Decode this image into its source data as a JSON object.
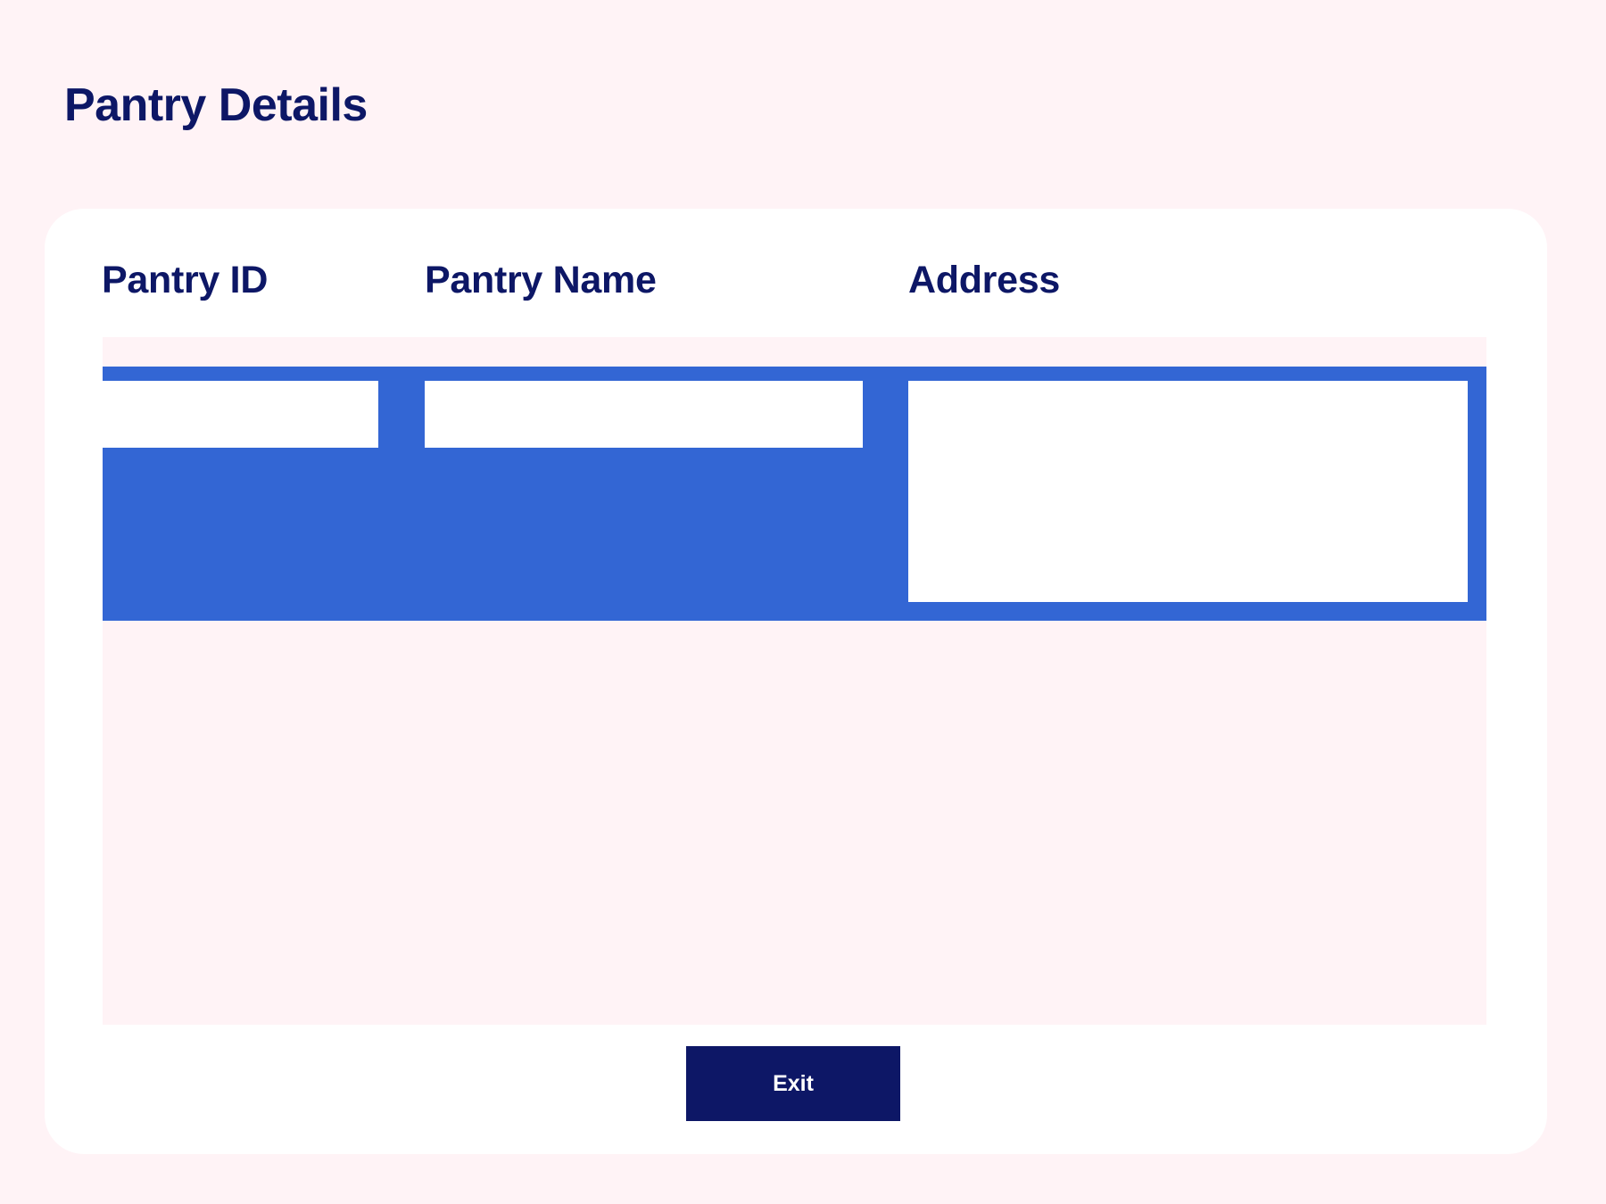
{
  "page": {
    "title": "Pantry Details"
  },
  "table": {
    "columns": [
      "Pantry ID",
      "Pantry Name",
      "Address"
    ],
    "selected_row": {
      "pantry_id": "",
      "pantry_name": "",
      "address": ""
    }
  },
  "actions": {
    "exit_label": "Exit"
  },
  "colors": {
    "background": "#fff3f6",
    "primary_text": "#0d1766",
    "selection": "#3366d4",
    "button": "#0d1766"
  }
}
